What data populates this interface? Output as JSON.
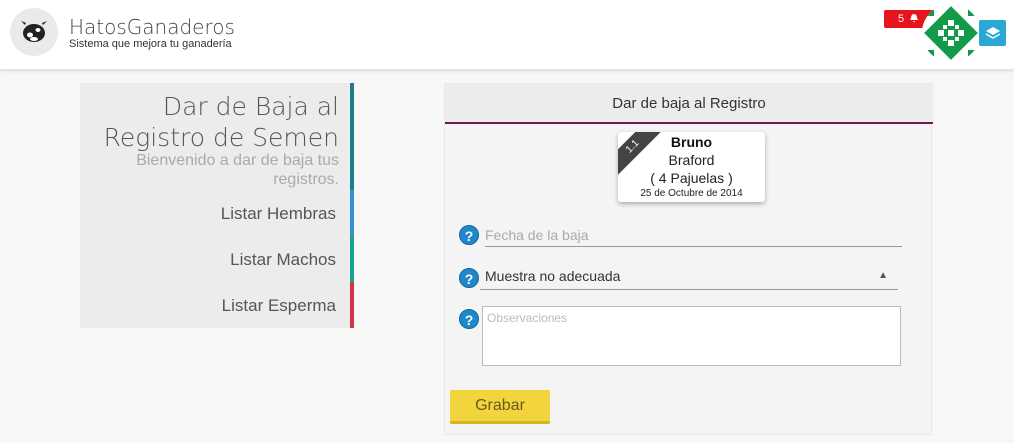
{
  "header": {
    "brand": "HatosGanaderos",
    "tagline": "Sistema que mejora tu ganadería",
    "notification_count": "5"
  },
  "sidebar": {
    "title": "Dar de Baja al Registro de Semen",
    "subtitle": "Bienvenido a dar de baja tus registros.",
    "links": [
      "Listar Hembras",
      "Listar Machos",
      "Listar Esperma"
    ],
    "colors": {
      "top": "#1f7a8c",
      "hembras": "#3a8fd1",
      "machos": "#17a589",
      "esperma": "#d63547"
    }
  },
  "form": {
    "header": "Dar de baja al Registro",
    "card": {
      "ribbon": "1.1",
      "name": "Bruno",
      "breed": "Braford",
      "straws": "( 4 Pajuelas )",
      "date": "25 de Octubre de 2014"
    },
    "date_placeholder": "Fecha de la baja",
    "reason_selected": "Muestra no adecuada",
    "observations_placeholder": "Observaciones",
    "help_symbol": "?",
    "save_label": "Grabar"
  },
  "colors": {
    "accent": "#6f1a52",
    "button": "#f2d43d",
    "help": "#1e88c9"
  }
}
